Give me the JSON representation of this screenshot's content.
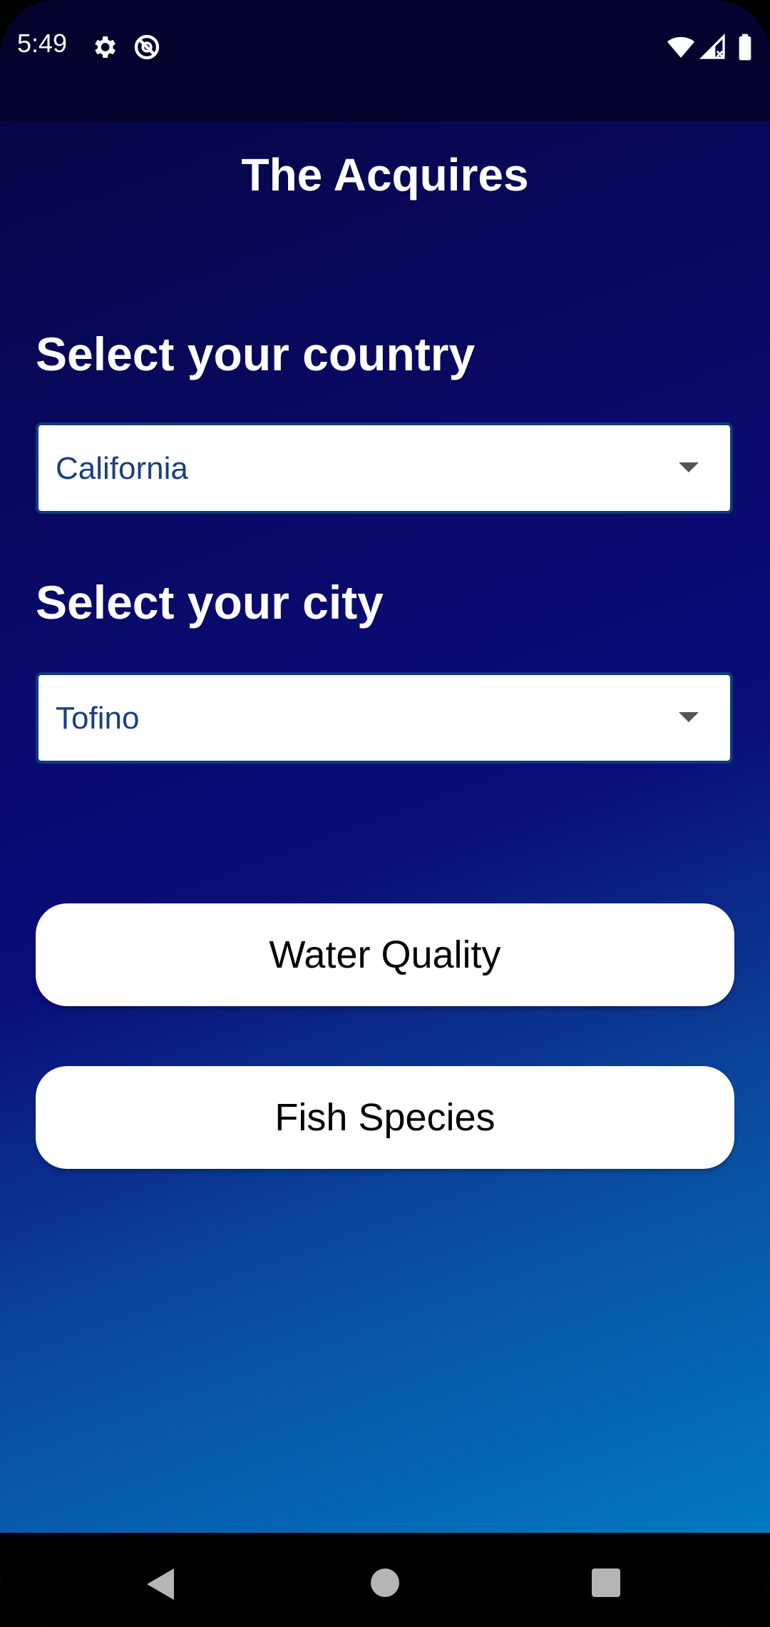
{
  "status_bar": {
    "time": "5:49",
    "icons_left": [
      "settings-icon",
      "no-sync-icon"
    ],
    "icons_right": [
      "wifi-icon",
      "signal-icon",
      "battery-icon"
    ]
  },
  "app": {
    "title": "The Acquires"
  },
  "country": {
    "label": "Select your country",
    "selected": "California"
  },
  "city": {
    "label": "Select your city",
    "selected": "Tofino"
  },
  "buttons": {
    "water_quality": "Water Quality",
    "fish_species": "Fish Species"
  },
  "nav": {
    "icons": [
      "back-icon",
      "home-icon",
      "recents-icon"
    ]
  },
  "colors": {
    "gradient_top": "#05053f",
    "gradient_mid": "#0a0a6e",
    "gradient_bottom": "#0082c8",
    "dropdown_text": "#1c3f7f"
  }
}
